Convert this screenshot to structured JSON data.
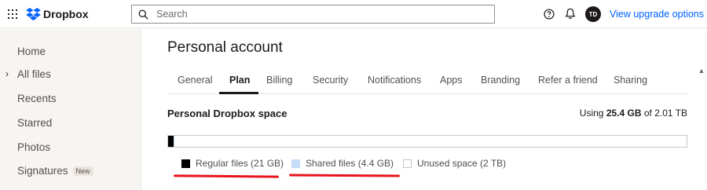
{
  "app": {
    "name": "Dropbox",
    "brand_color": "#0061fe"
  },
  "header": {
    "search_placeholder": "Search",
    "avatar_initials": "TD",
    "upgrade_link": "View upgrade options",
    "icons": [
      "apps-grid-icon",
      "dropbox-logo-icon",
      "search-icon",
      "help-icon",
      "bell-icon"
    ]
  },
  "sidebar": {
    "items": [
      {
        "label": "Home"
      },
      {
        "label": "All files",
        "expandable": true
      },
      {
        "label": "Recents"
      },
      {
        "label": "Starred"
      },
      {
        "label": "Photos"
      },
      {
        "label": "Signatures",
        "badge": "New"
      }
    ]
  },
  "main": {
    "title": "Personal account",
    "tabs": [
      {
        "label": "General"
      },
      {
        "label": "Plan",
        "active": true
      },
      {
        "label": "Billing"
      },
      {
        "label": "Security"
      },
      {
        "label": "Notifications"
      },
      {
        "label": "Apps"
      },
      {
        "label": "Branding"
      },
      {
        "label": "Refer a friend"
      },
      {
        "label": "Sharing"
      }
    ],
    "space": {
      "title": "Personal Dropbox space",
      "usage_prefix": "Using ",
      "usage_amount": "25.4 GB",
      "usage_suffix": " of 2.01 TB",
      "bar_segments": [
        {
          "name": "regular",
          "fraction": 0.0101,
          "color": "#000000"
        },
        {
          "name": "shared",
          "fraction": 0.0021,
          "color": "#c7dcf7"
        }
      ],
      "legend": [
        {
          "label": "Regular files (21 GB)",
          "color": "#000000"
        },
        {
          "label": "Shared files (4.4 GB)",
          "color": "#c7dcf7"
        },
        {
          "label": "Unused space (2 TB)",
          "color": "#ffffff"
        }
      ]
    }
  },
  "annotations": {
    "marker_color": "#e8141d"
  }
}
